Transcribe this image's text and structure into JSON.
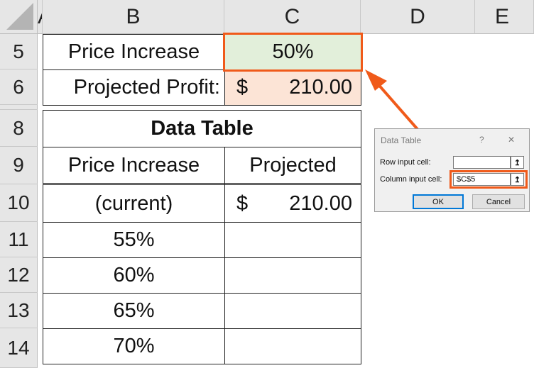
{
  "columns": [
    "A",
    "B",
    "C",
    "D",
    "E"
  ],
  "rows": [
    "5",
    "6",
    "8",
    "9",
    "10",
    "11",
    "12",
    "13",
    "14"
  ],
  "inputs": {
    "price_increase_label": "Price Increase",
    "price_increase_value": "50%",
    "projected_profit_label": "Projected Profit:",
    "projected_profit_currency": "$",
    "projected_profit_value": "210.00"
  },
  "data_table": {
    "title": "Data Table",
    "headers": [
      "Price Increase",
      "Projected"
    ],
    "rows": [
      {
        "label": "(current)",
        "currency": "$",
        "value": "210.00"
      },
      {
        "label": "55%"
      },
      {
        "label": "60%"
      },
      {
        "label": "65%"
      },
      {
        "label": "70%"
      }
    ]
  },
  "dialog": {
    "title": "Data Table",
    "help": "?",
    "close": "✕",
    "row_input_label": "Row input cell:",
    "row_input_value": "",
    "column_input_label": "Column input cell:",
    "column_input_value": "$C$5",
    "ok": "OK",
    "cancel": "Cancel",
    "collapse_icon": "↥"
  },
  "colors": {
    "highlight": "#f05a1a",
    "input_fill": "#e2efda",
    "output_fill": "#fce4d6",
    "ok_border": "#0078d7"
  }
}
